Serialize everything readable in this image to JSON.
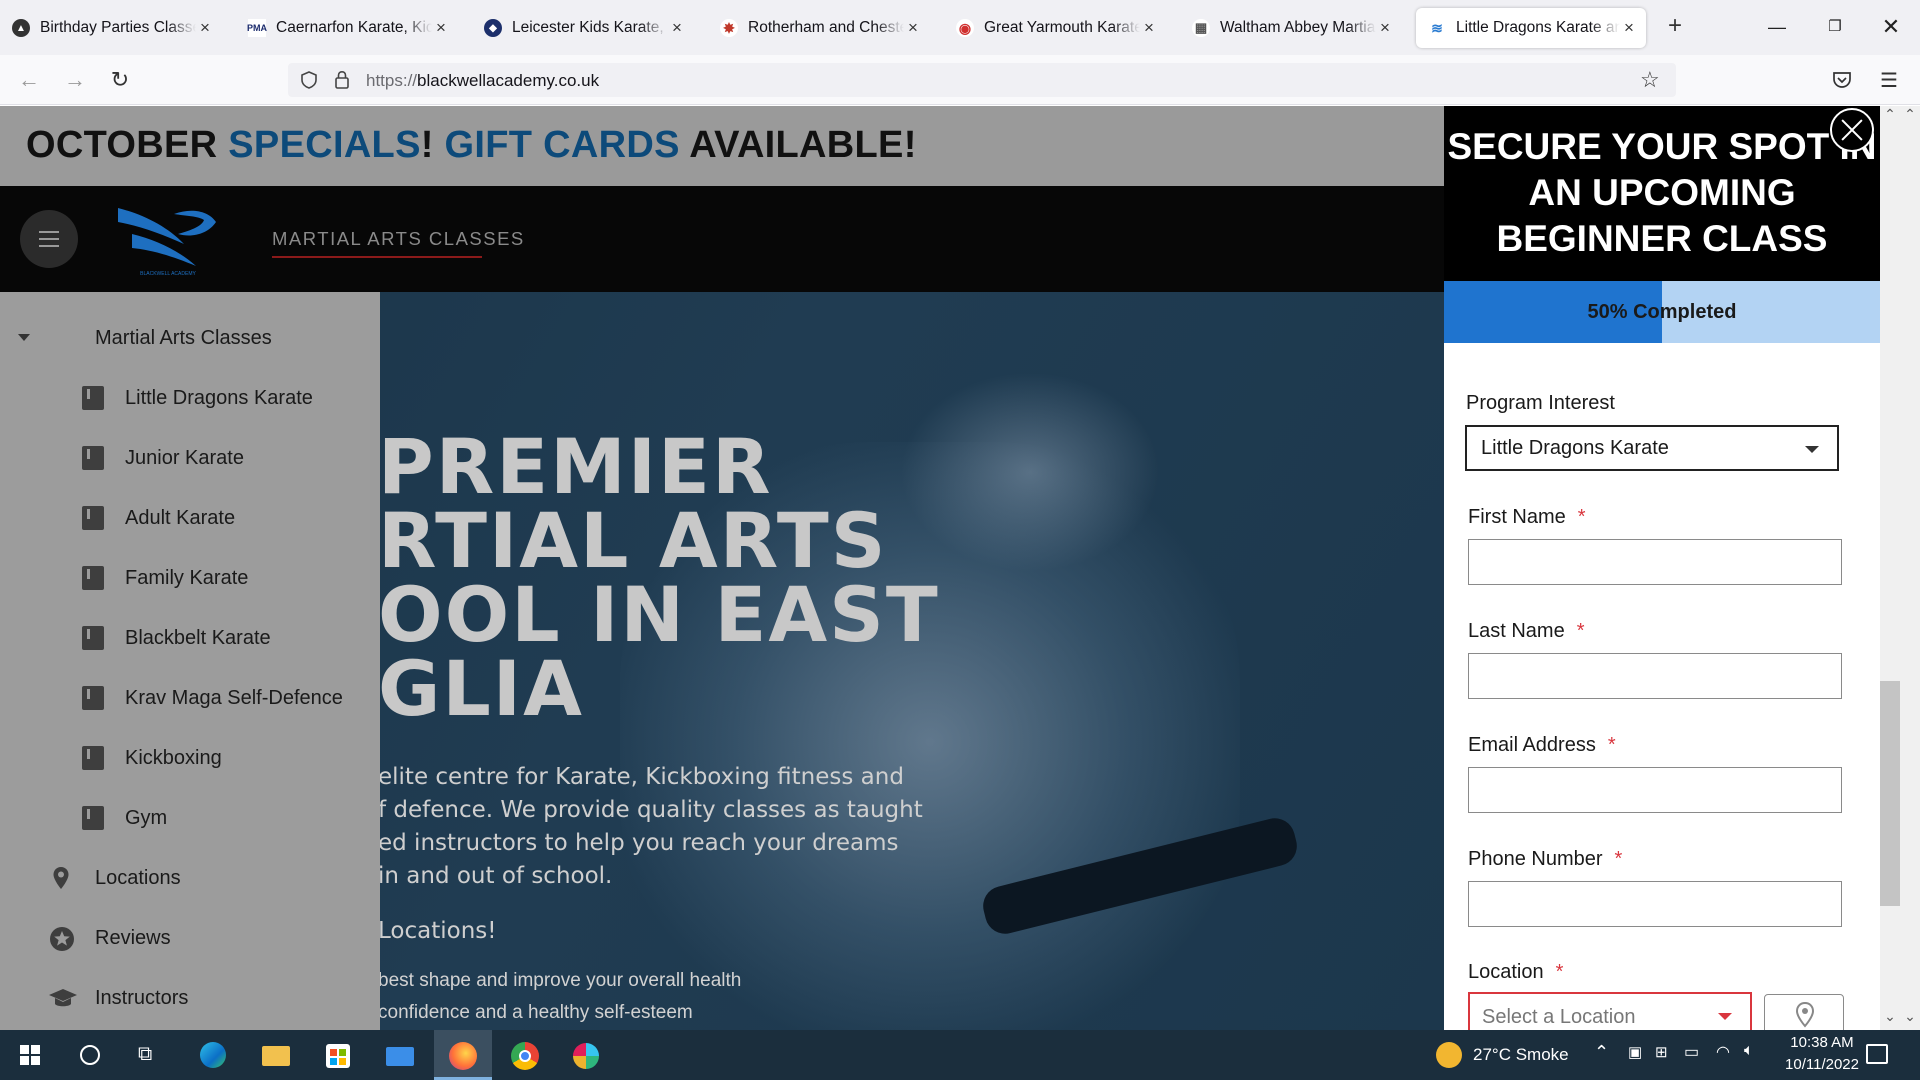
{
  "browser": {
    "tabs": [
      {
        "title": "Birthday Parties Classes &",
        "favicon_color": "#333333",
        "favicon_glyph": "▲"
      },
      {
        "title": "Caernarfon Karate, Kickb",
        "favicon_color": "#1a2a6c",
        "favicon_glyph": "PMA"
      },
      {
        "title": "Leicester Kids Karate, Kic",
        "favicon_color": "#1c2f6b",
        "favicon_glyph": "◆"
      },
      {
        "title": "Rotherham and Chesterfi",
        "favicon_color": "#c0392b",
        "favicon_glyph": "✸"
      },
      {
        "title": "Great Yarmouth Karate, K",
        "favicon_color": "#d0302f",
        "favicon_glyph": "◉"
      },
      {
        "title": "Waltham Abbey Martial",
        "favicon_color": "#555555",
        "favicon_glyph": "▦"
      },
      {
        "title": "Little Dragons Karate anc",
        "favicon_color": "#2a7bd1",
        "favicon_glyph": "≋"
      }
    ],
    "new_tab_label": "+",
    "url_protocol": "https://",
    "url_host": "blackwellacademy.co.uk"
  },
  "promo": {
    "part1": "OCTOBER ",
    "part2": "SPECIALS",
    "part3": "! ",
    "part4": "GIFT CARDS",
    "part5": " AVAILABLE!"
  },
  "header": {
    "nav_label": "MARTIAL ARTS CLASSES",
    "logo_text": "BLACKWELL ACADEMY"
  },
  "sidemenu": {
    "section_label": "Martial Arts Classes",
    "classes": [
      "Little Dragons Karate",
      "Junior Karate",
      "Adult Karate",
      "Family Karate",
      "Blackbelt Karate",
      "Krav Maga Self-Defence",
      "Kickboxing",
      "Gym"
    ],
    "locations": "Locations",
    "reviews": "Reviews",
    "instructors": "Instructors"
  },
  "hero": {
    "line1": "PREMIER",
    "line2": "RTIAL ARTS",
    "line3": "OOL IN EAST",
    "line4": "GLIA",
    "p1": "elite centre for Karate, Kickboxing fitness and",
    "p2": "f defence. We provide quality classes as taught",
    "p3": "ed instructors to help you reach your dreams",
    "p4": "in and out of school.",
    "locations_line": "Locations!",
    "s1": "best shape and improve your overall health",
    "s2": "confidence and a healthy self-esteem"
  },
  "modal": {
    "title": "SECURE YOUR SPOT IN AN UPCOMING BEGINNER CLASS",
    "progress_percent": 50,
    "progress_text": "50% Completed",
    "program_label": "Program Interest",
    "program_value": "Little Dragons Karate",
    "first_name_label": "First Name",
    "last_name_label": "Last Name",
    "email_label": "Email Address",
    "phone_label": "Phone Number",
    "location_label": "Location",
    "location_placeholder": "Select a Location",
    "required_mark": "*"
  },
  "taskbar": {
    "weather": "27°C  Smoke",
    "time": "10:38 AM",
    "date": "10/11/2022"
  },
  "colors": {
    "promo_highlight": "#0d4a7a",
    "progress_fill": "#1f74cf",
    "progress_track": "#b3d3f3",
    "required": "#d9363e",
    "location_error_border": "#d9363e"
  }
}
